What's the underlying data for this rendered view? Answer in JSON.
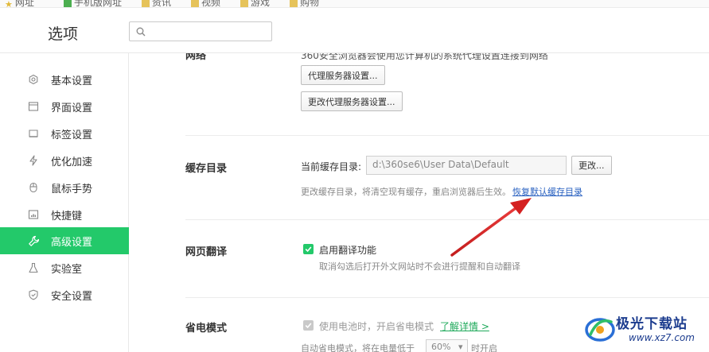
{
  "bookmarks": {
    "items": [
      {
        "label": "网址"
      },
      {
        "label": "手机版网址"
      },
      {
        "label": "资讯"
      },
      {
        "label": "视频"
      },
      {
        "label": "游戏"
      },
      {
        "label": "购物"
      }
    ]
  },
  "header": {
    "title": "选项",
    "search_placeholder": "",
    "search_value": ""
  },
  "sidebar": {
    "items": [
      {
        "label": "基本设置",
        "icon": "gear-icon"
      },
      {
        "label": "界面设置",
        "icon": "window-icon"
      },
      {
        "label": "标签设置",
        "icon": "tab-icon"
      },
      {
        "label": "优化加速",
        "icon": "lightning-icon"
      },
      {
        "label": "鼠标手势",
        "icon": "mouse-icon"
      },
      {
        "label": "快捷键",
        "icon": "keyboard-icon"
      },
      {
        "label": "高级设置",
        "icon": "wrench-icon",
        "active": true
      },
      {
        "label": "实验室",
        "icon": "flask-icon"
      },
      {
        "label": "安全设置",
        "icon": "shield-icon"
      }
    ]
  },
  "network": {
    "title": "网络",
    "desc": "360安全浏览器会使用您计算机的系统代理设置连接到网络",
    "proxy_button": "代理服务器设置...",
    "change_proxy_button": "更改代理服务器设置..."
  },
  "cache": {
    "title": "缓存目录",
    "current_label": "当前缓存目录:",
    "path_value": "d:\\360se6\\User Data\\Default",
    "change_button": "更改...",
    "desc": "更改缓存目录，将清空现有缓存，重启浏览器后生效。",
    "restore_link": "恢复默认缓存目录"
  },
  "translate": {
    "title": "网页翻译",
    "checkbox_label": "启用翻译功能",
    "checked": true,
    "desc": "取消勾选后打开外文网站时不会进行提醒和自动翻译"
  },
  "power": {
    "title": "省电模式",
    "checkbox_label": "使用电池时，开启省电模式",
    "checked": true,
    "learn_more": "了解详情 >",
    "auto_prefix": "自动省电模式，将在电量低于",
    "threshold": "60%",
    "auto_suffix": "时开启"
  },
  "watermark": {
    "name": "极光下载站",
    "url": "www.xz7.com"
  },
  "colors": {
    "accent": "#23c96a",
    "link": "#2860c0",
    "arrow": "#d42020"
  }
}
